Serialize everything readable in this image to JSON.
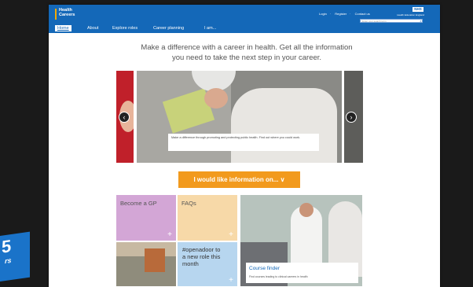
{
  "header": {
    "logo": {
      "line1": "Health",
      "line2": "Careers"
    },
    "top_links": [
      "Login",
      "Register",
      "Contact us"
    ],
    "nhs_logo": "NHS",
    "org_name": "Health Education England",
    "search_placeholder": "Enter your search term",
    "search_icon": "magnifier"
  },
  "nav": {
    "items": [
      "Home",
      "About",
      "Explore roles",
      "Career planning",
      "I am..."
    ],
    "active": "Home"
  },
  "headline": {
    "line1": "Make a difference with a career in health. Get all the information",
    "line2": "you need to take the next step in your career."
  },
  "carousel": {
    "caption": "Make a difference through promoting and protecting public health. Find out where you could work.",
    "prev_icon": "circle-arrow-left",
    "next_icon": "circle-arrow-right"
  },
  "cta": {
    "label": "I would like information on... ∨"
  },
  "tiles": {
    "gp": {
      "label": "Become a GP",
      "plus": "+"
    },
    "faq": {
      "label": "FAQs",
      "plus": "+"
    },
    "openadoor": {
      "line1": "#openadoor to",
      "line2": "a new role this",
      "line3": "month",
      "plus": "+"
    },
    "course_finder": {
      "title": "Course finder",
      "subtitle": "Find courses leading to clinical careers in health"
    }
  },
  "badge": {
    "number": "5",
    "text": "rs"
  },
  "colors": {
    "brand_blue": "#1468b8",
    "cta_orange": "#f29a1d",
    "tile_purple": "#d3a6d6",
    "tile_peach": "#f7d9a8",
    "tile_blue": "#b7d6ef"
  }
}
